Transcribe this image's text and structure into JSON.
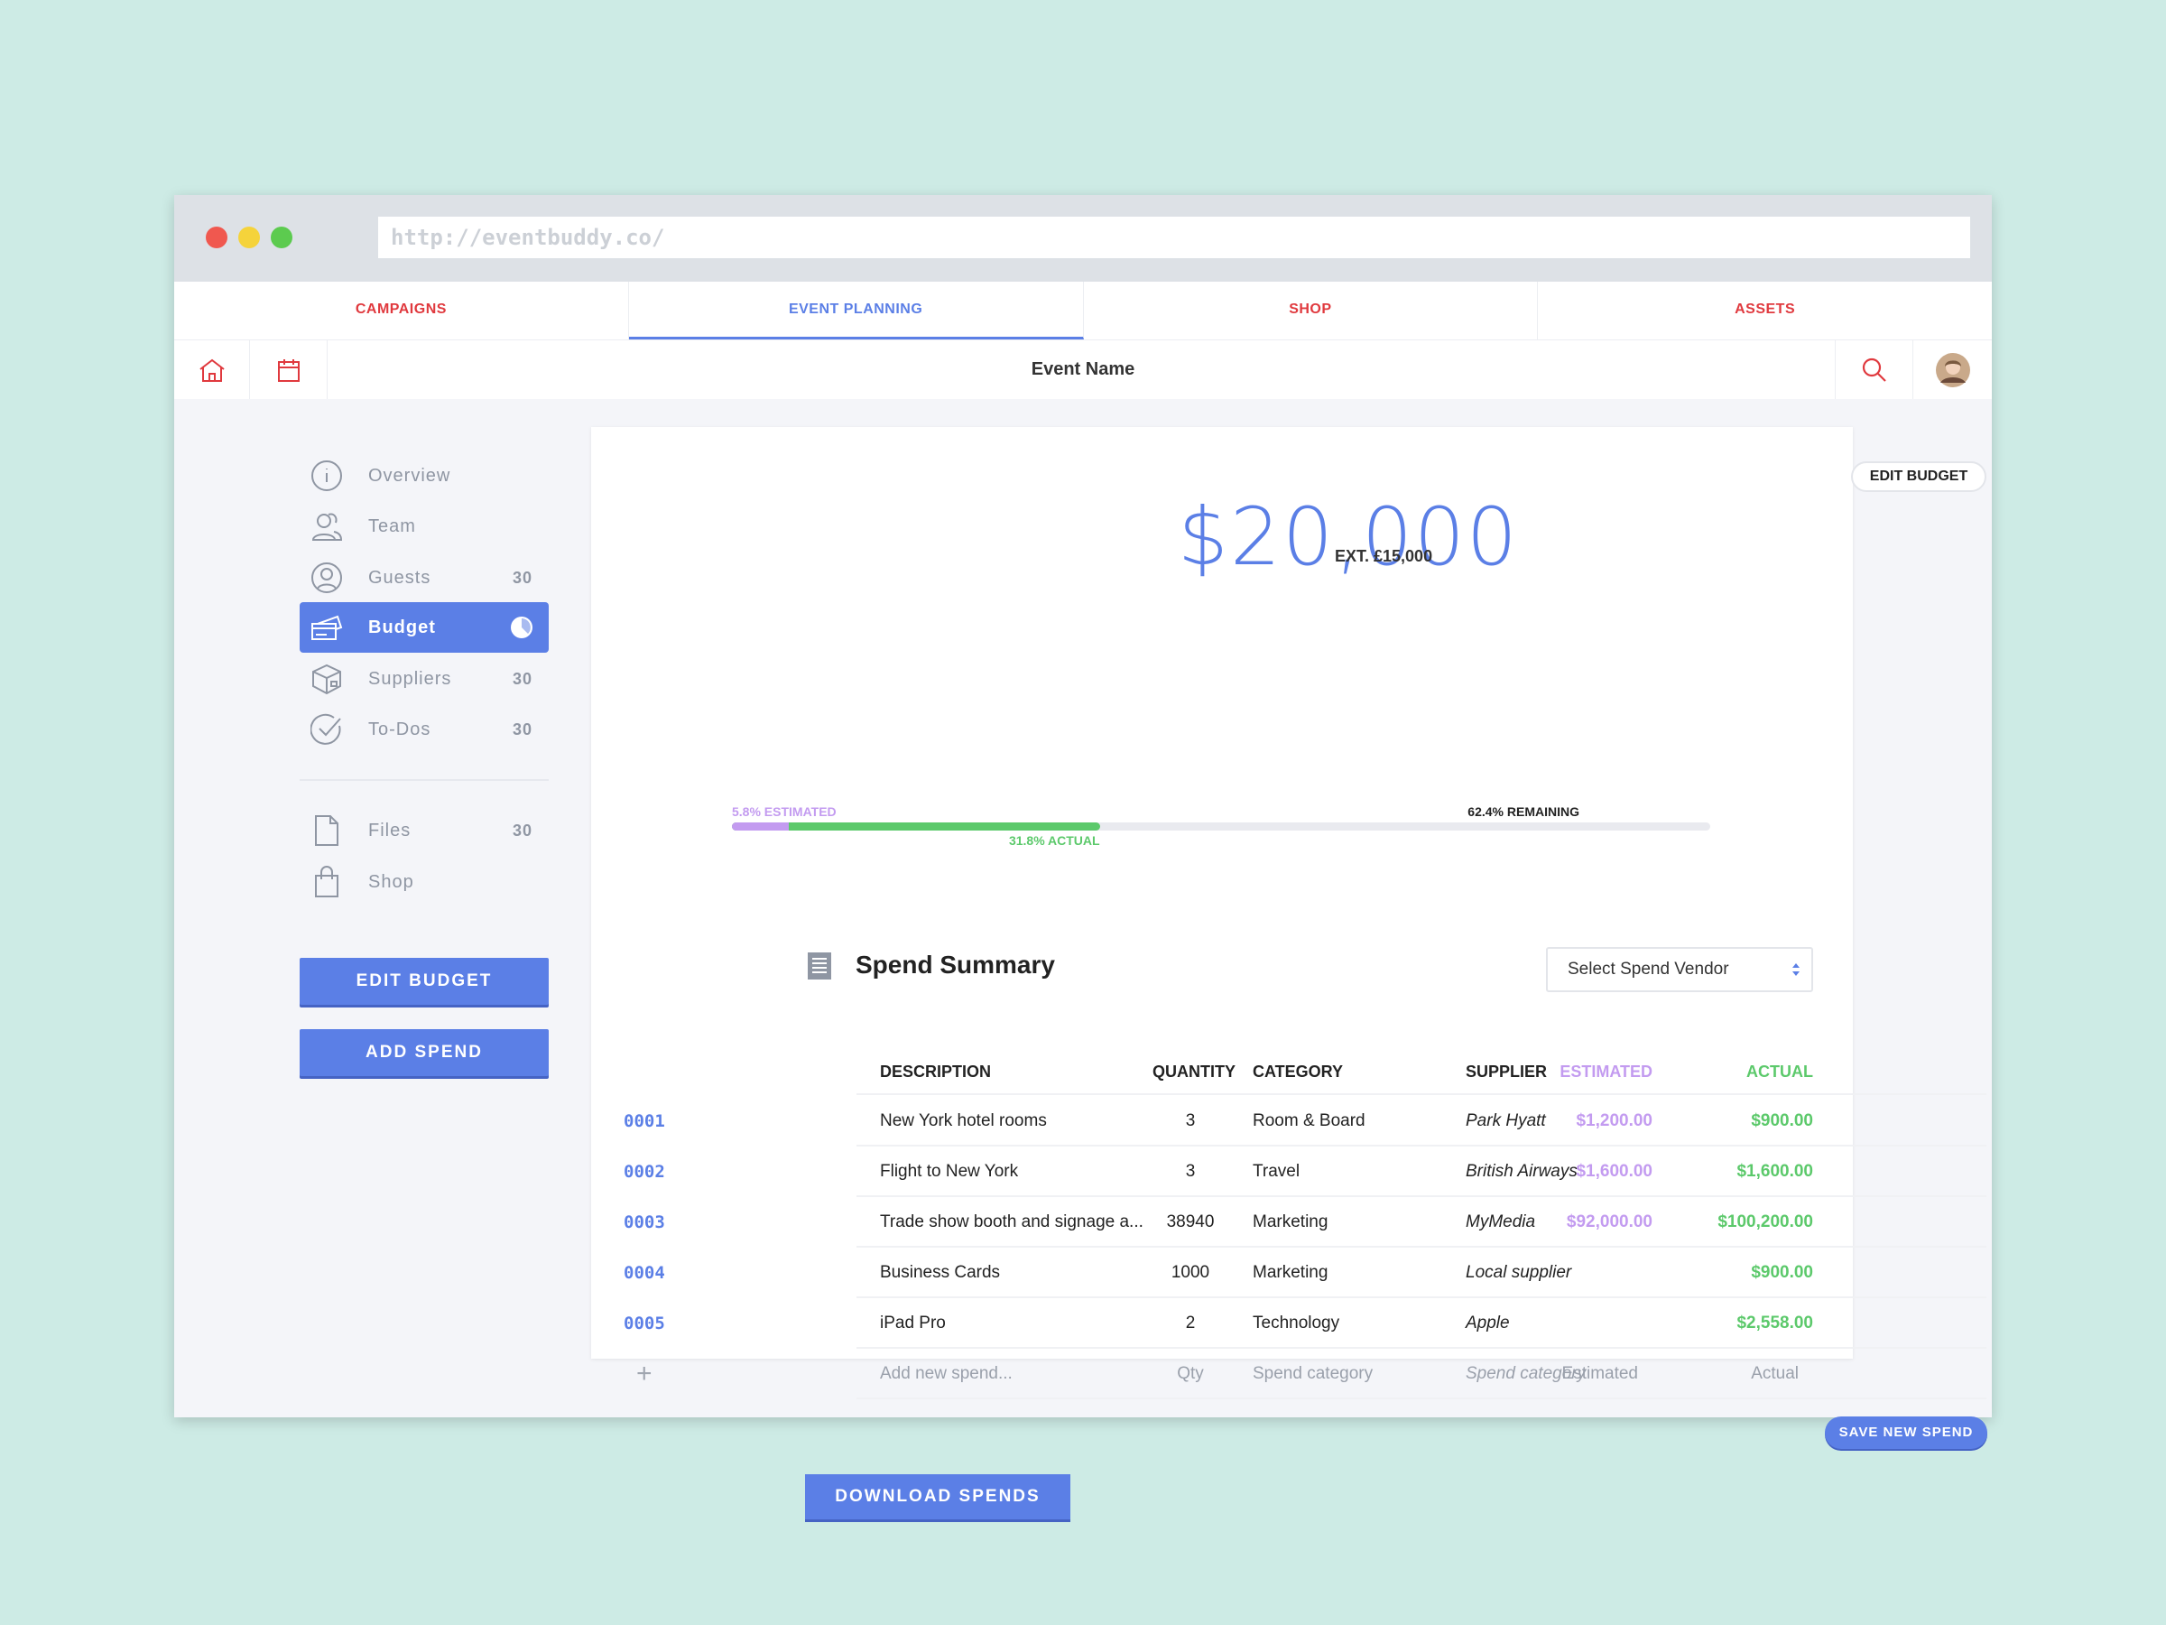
{
  "browser": {
    "url": "http://eventbuddy.co/"
  },
  "tabs": [
    {
      "label": "CAMPAIGNS"
    },
    {
      "label": "EVENT PLANNING",
      "active": true
    },
    {
      "label": "SHOP"
    },
    {
      "label": "ASSETS"
    }
  ],
  "header": {
    "title": "Event Name"
  },
  "sidebar": {
    "items": [
      {
        "label": "Overview",
        "icon": "info-icon"
      },
      {
        "label": "Team",
        "icon": "team-icon"
      },
      {
        "label": "Guests",
        "count": "30",
        "icon": "guest-icon"
      },
      {
        "label": "Budget",
        "icon": "credit-card-icon",
        "active": true
      },
      {
        "label": "Suppliers",
        "count": "30",
        "icon": "box-icon"
      },
      {
        "label": "To-Dos",
        "count": "30",
        "icon": "check-circle-icon"
      },
      {
        "label": "Files",
        "count": "30",
        "icon": "file-icon"
      },
      {
        "label": "Shop",
        "icon": "bag-icon"
      }
    ],
    "edit_budget": "EDIT BUDGET",
    "add_spend": "ADD SPEND"
  },
  "budget": {
    "edit_label": "EDIT BUDGET",
    "amount": "$20,000",
    "ext": "EXT. £15,000",
    "estimated_label": "5.8% ESTIMATED",
    "actual_label": "31.8% ACTUAL",
    "remaining_label": "62.4% REMAINING",
    "estimated_pct": 5.8,
    "actual_pct": 31.8,
    "remaining_pct": 62.4
  },
  "summary": {
    "title": "Spend Summary",
    "vendor_select": "Select Spend Vendor",
    "columns": {
      "description": "DESCRIPTION",
      "quantity": "QUANTITY",
      "category": "CATEGORY",
      "supplier": "SUPPLIER",
      "estimated": "ESTIMATED",
      "actual": "ACTUAL"
    },
    "rows": [
      {
        "id": "0001",
        "description": "New York hotel rooms",
        "quantity": "3",
        "category": "Room & Board",
        "supplier": "Park Hyatt",
        "estimated": "$1,200.00",
        "actual": "$900.00"
      },
      {
        "id": "0002",
        "description": "Flight to New York",
        "quantity": "3",
        "category": "Travel",
        "supplier": "British Airways",
        "estimated": "$1,600.00",
        "actual": "$1,600.00"
      },
      {
        "id": "0003",
        "description": "Trade show booth and signage a...",
        "quantity": "38940",
        "category": "Marketing",
        "supplier": "MyMedia",
        "estimated": "$92,000.00",
        "actual": "$100,200.00"
      },
      {
        "id": "0004",
        "description": "Business Cards",
        "quantity": "1000",
        "category": "Marketing",
        "supplier": "Local supplier",
        "estimated": "",
        "actual": "$900.00"
      },
      {
        "id": "0005",
        "description": "iPad Pro",
        "quantity": "2",
        "category": "Technology",
        "supplier": "Apple",
        "estimated": "",
        "actual": "$2,558.00"
      }
    ],
    "new_row": {
      "description": "Add new spend...",
      "quantity": "Qty",
      "category": "Spend category",
      "supplier": "Spend category",
      "estimated": "Estimated",
      "actual": "Actual"
    },
    "save_label": "SAVE NEW SPEND",
    "download_label": "DOWNLOAD SPENDS"
  },
  "colors": {
    "accent": "#5b7fe6",
    "tab_red": "#e0393e",
    "estimated": "#c39bf0",
    "actual": "#5cc96b"
  }
}
